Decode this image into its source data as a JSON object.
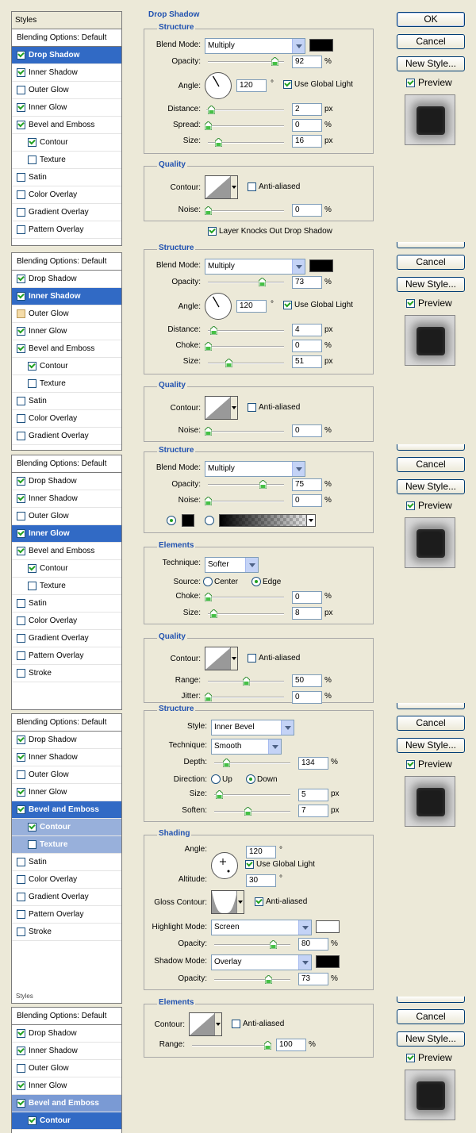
{
  "buttons": {
    "ok": "OK",
    "cancel": "Cancel",
    "new_style": "New Style...",
    "preview": "Preview"
  },
  "style_list": {
    "header": "Styles",
    "blending": "Blending Options: Default",
    "items": {
      "drop_shadow": "Drop Shadow",
      "inner_shadow": "Inner Shadow",
      "outer_glow": "Outer Glow",
      "inner_glow": "Inner Glow",
      "bevel_emboss": "Bevel and Emboss",
      "contour": "Contour",
      "texture": "Texture",
      "satin": "Satin",
      "color_overlay": "Color Overlay",
      "gradient_overlay": "Gradient Overlay",
      "pattern_overlay": "Pattern Overlay",
      "stroke": "Stroke"
    }
  },
  "drop_shadow": {
    "section_title": "Drop Shadow",
    "structure": "Structure",
    "blend_mode_label": "Blend Mode:",
    "blend_mode": "Multiply",
    "opacity_label": "Opacity:",
    "opacity": "92",
    "angle_label": "Angle:",
    "angle": "120",
    "use_global_light": "Use Global Light",
    "distance_label": "Distance:",
    "distance": "2",
    "spread_label": "Spread:",
    "spread": "0",
    "size_label": "Size:",
    "size": "16",
    "quality": "Quality",
    "contour_label": "Contour:",
    "anti_aliased": "Anti-aliased",
    "noise_label": "Noise:",
    "noise": "0",
    "layer_knocks_out": "Layer Knocks Out Drop Shadow"
  },
  "inner_shadow": {
    "structure": "Structure",
    "blend_mode_label": "Blend Mode:",
    "blend_mode": "Multiply",
    "opacity_label": "Opacity:",
    "opacity": "73",
    "angle_label": "Angle:",
    "angle": "120",
    "use_global_light": "Use Global Light",
    "distance_label": "Distance:",
    "distance": "4",
    "choke_label": "Choke:",
    "choke": "0",
    "size_label": "Size:",
    "size": "51",
    "quality": "Quality",
    "contour_label": "Contour:",
    "anti_aliased": "Anti-aliased",
    "noise_label": "Noise:",
    "noise": "0"
  },
  "inner_glow": {
    "structure": "Structure",
    "blend_mode_label": "Blend Mode:",
    "blend_mode": "Multiply",
    "opacity_label": "Opacity:",
    "opacity": "75",
    "noise_label": "Noise:",
    "noise": "0",
    "elements": "Elements",
    "technique_label": "Technique:",
    "technique": "Softer",
    "source_label": "Source:",
    "center": "Center",
    "edge": "Edge",
    "choke_label": "Choke:",
    "choke": "0",
    "size_label": "Size:",
    "size": "8",
    "quality": "Quality",
    "contour_label": "Contour:",
    "anti_aliased": "Anti-aliased",
    "range_label": "Range:",
    "range": "50",
    "jitter_label": "Jitter:",
    "jitter": "0"
  },
  "bevel": {
    "structure": "Structure",
    "style_label": "Style:",
    "style": "Inner Bevel",
    "technique_label": "Technique:",
    "technique": "Smooth",
    "depth_label": "Depth:",
    "depth": "134",
    "direction_label": "Direction:",
    "up": "Up",
    "down": "Down",
    "size_label": "Size:",
    "size": "5",
    "soften_label": "Soften:",
    "soften": "7",
    "shading": "Shading",
    "angle_label": "Angle:",
    "angle": "120",
    "use_global_light": "Use Global Light",
    "altitude_label": "Altitude:",
    "altitude": "30",
    "gloss_contour_label": "Gloss Contour:",
    "anti_aliased": "Anti-aliased",
    "highlight_mode_label": "Highlight Mode:",
    "highlight_mode": "Screen",
    "highlight_opacity_label": "Opacity:",
    "highlight_opacity": "80",
    "shadow_mode_label": "Shadow Mode:",
    "shadow_mode": "Overlay",
    "shadow_opacity_label": "Opacity:",
    "shadow_opacity": "73"
  },
  "contour": {
    "elements": "Elements",
    "contour_label": "Contour:",
    "anti_aliased": "Anti-aliased",
    "range_label": "Range:",
    "range": "100"
  },
  "units": {
    "percent": "%",
    "px": "px",
    "degree": "°"
  },
  "colors": {
    "selection": "#316ac5",
    "section_title": "#2152b0",
    "shadow_color": "#000000",
    "highlight_color": "#ffffff"
  }
}
